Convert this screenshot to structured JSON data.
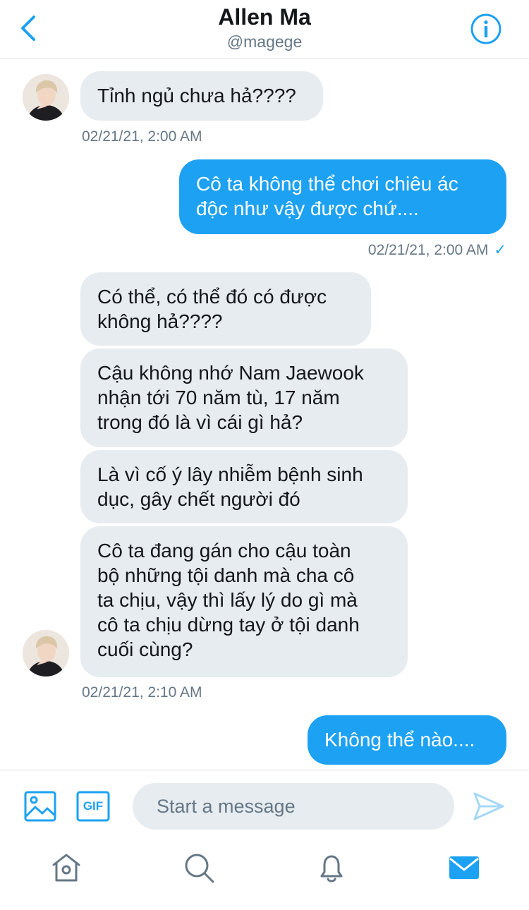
{
  "header": {
    "name": "Allen Ma",
    "handle": "@magege"
  },
  "messages": {
    "m1": "Tỉnh ngủ chưa hả????",
    "ts1": "02/21/21, 2:00 AM",
    "m2_line1": "Cô ta không thể chơi chiêu ác",
    "m2_line2": "độc như vậy được chứ....",
    "ts2": "02/21/21, 2:00 AM",
    "ts2_check": "✓",
    "m3_line1": "Có thể, có thể đó có được",
    "m3_line2": "không hả????",
    "m4_line1": "Cậu không nhớ Nam Jaewook",
    "m4_line2": "nhận tới 70 năm tù, 17 năm",
    "m4_line3": "trong đó là vì cái gì hả?",
    "m5_line1": "Là vì cố ý lây nhiễm bệnh sinh",
    "m5_line2": "dục, gây chết người đó",
    "m6_line1": "Cô ta đang gán cho cậu toàn",
    "m6_line2": "bộ những tội danh mà cha cô",
    "m6_line3": "ta chịu, vậy thì lấy lý do gì mà",
    "m6_line4": "cô ta chịu dừng tay ở tội danh",
    "m6_line5": "cuối cùng?",
    "ts3": "02/21/21, 2:10 AM",
    "m7": "Không thể nào...."
  },
  "composer": {
    "placeholder": "Start a message",
    "gif_label": "GIF"
  },
  "icons": {
    "back": "chevron-left-icon",
    "info": "info-icon",
    "image": "image-icon",
    "gif": "gif-icon",
    "send": "send-icon",
    "home": "home-icon",
    "search": "search-icon",
    "notifications": "bell-icon",
    "messages": "mail-icon"
  },
  "colors": {
    "accent": "#1da1f2",
    "incoming_bubble": "#e6ecf0",
    "secondary_text": "#657786"
  }
}
